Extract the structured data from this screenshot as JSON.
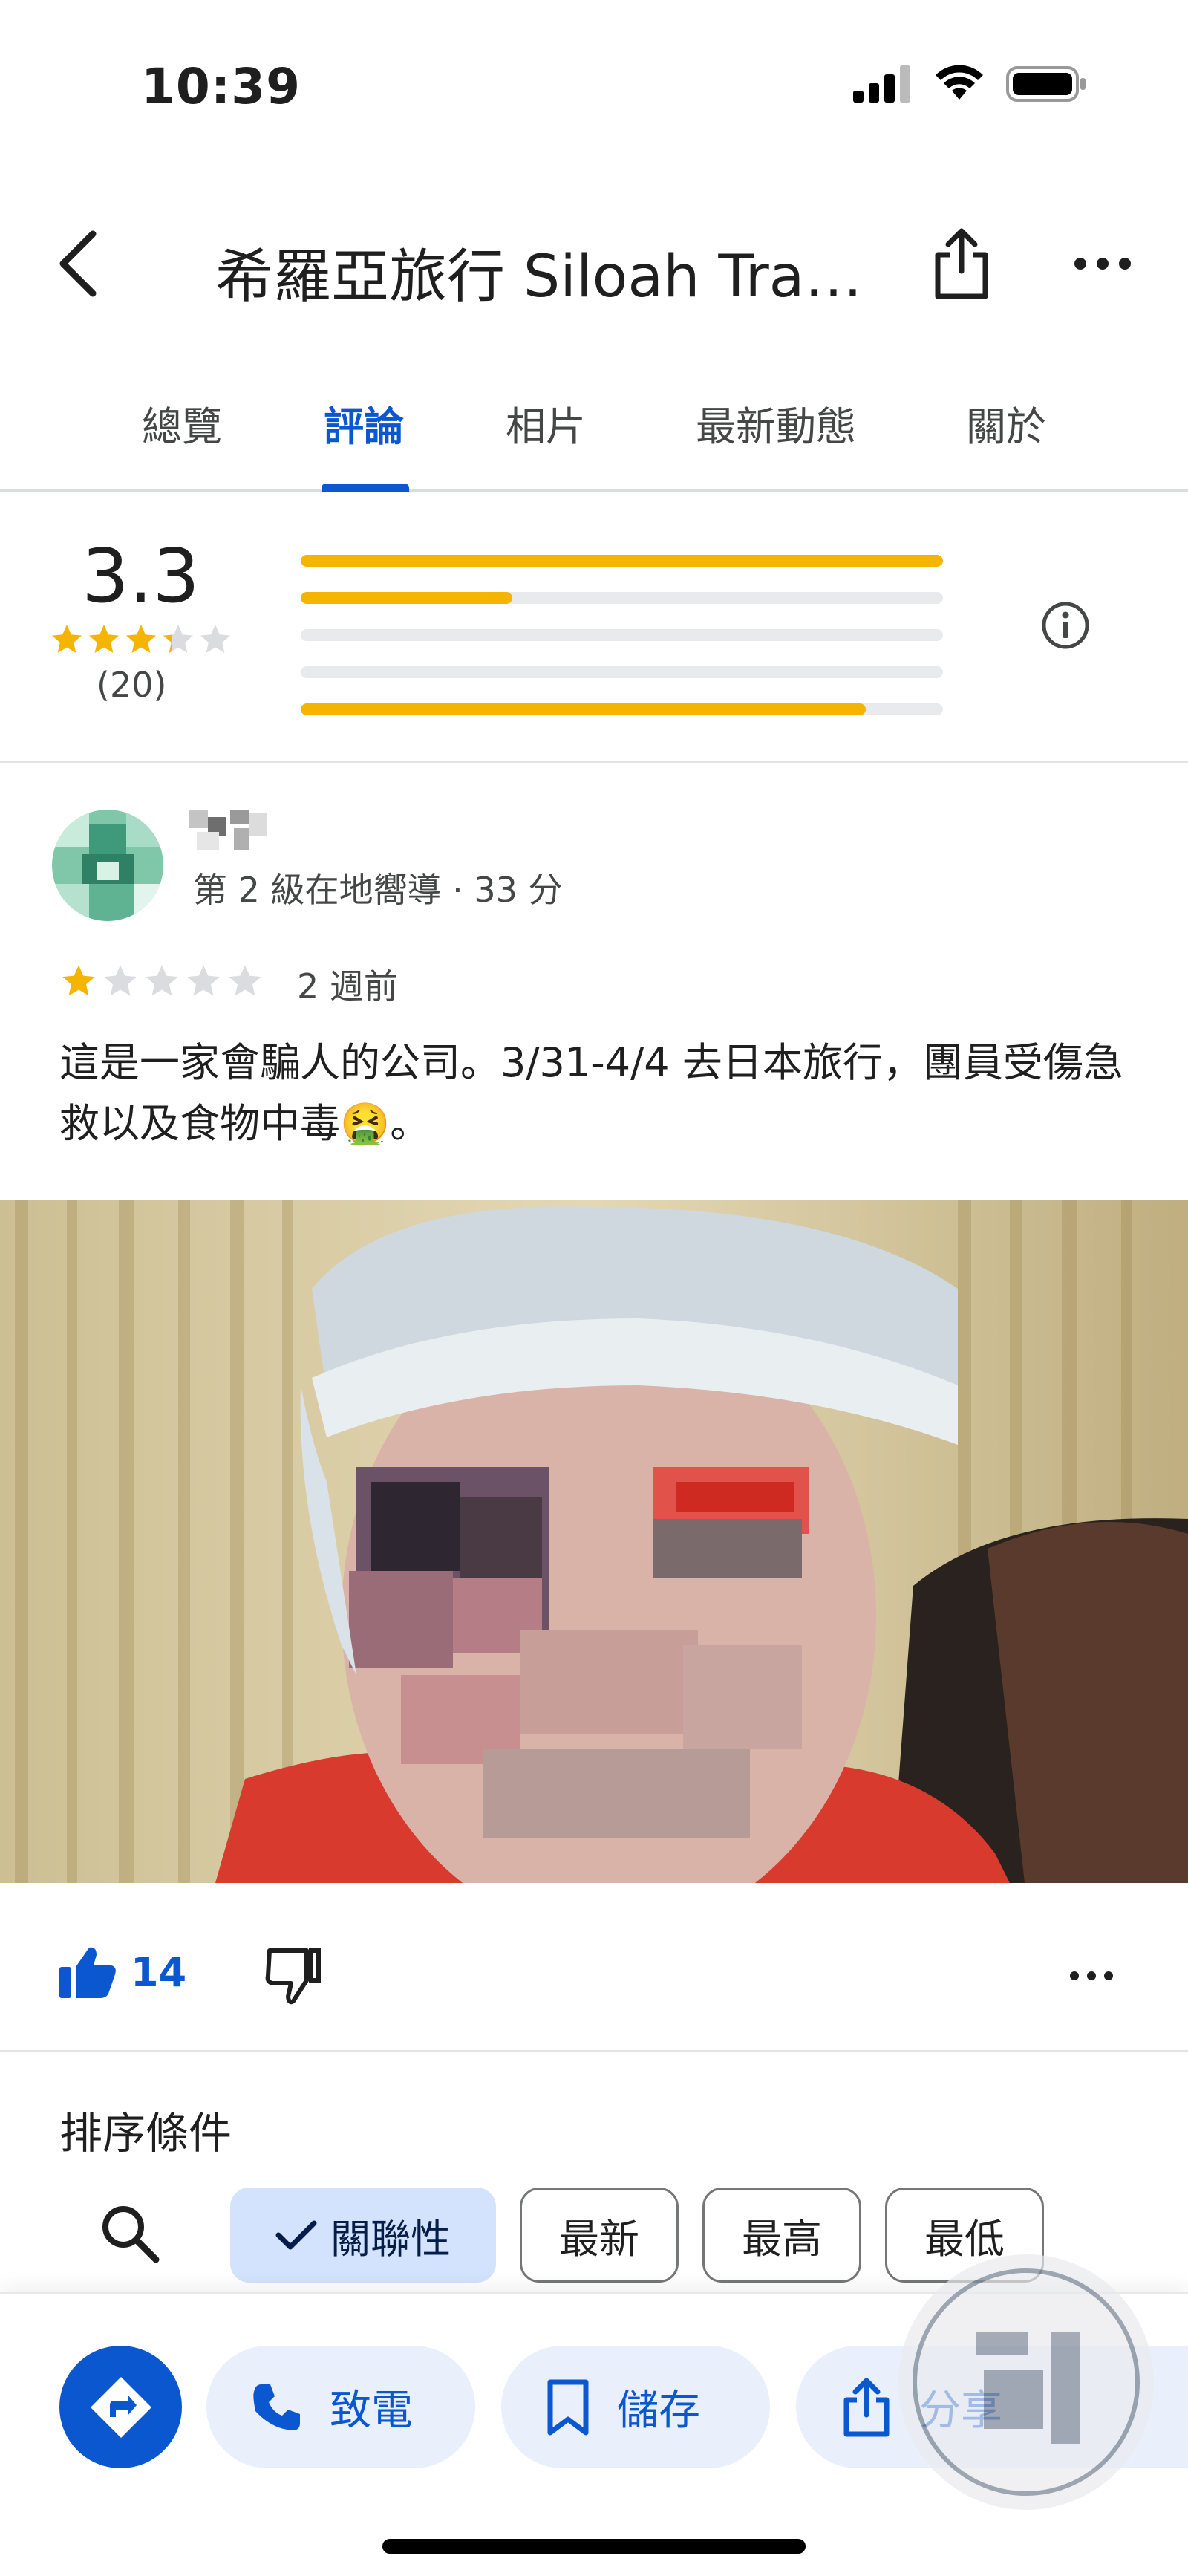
{
  "status_bar": {
    "time": "10:39"
  },
  "header": {
    "title": "希羅亞旅行 Siloah Trav..."
  },
  "tabs": [
    {
      "label": "總覽"
    },
    {
      "label": "評論"
    },
    {
      "label": "相片"
    },
    {
      "label": "最新動態"
    },
    {
      "label": "關於"
    }
  ],
  "active_tab": "評論",
  "rating": {
    "score": "3.3",
    "count": "(20)",
    "stars": 3.3,
    "distribution_fraction": [
      1.0,
      0.33,
      0.0,
      0.0,
      0.88
    ]
  },
  "review": {
    "reviewer_meta": "第 2 級在地嚮導 · 33 分",
    "stars": 1,
    "time": "2 週前",
    "text": "這是一家會騙人的公司。3/31-4/4 去日本旅行，團員受傷急救以及食物中毒🤮。",
    "like_count": "14"
  },
  "sort": {
    "title": "排序條件",
    "chips": [
      "關聯性",
      "最新",
      "最高",
      "最低"
    ],
    "selected": "關聯性"
  },
  "bottom_actions": {
    "call": "致電",
    "save": "儲存",
    "share": "分享"
  },
  "colors": {
    "accent": "#0b57d0",
    "star": "#f4b400",
    "chip_selected": "#d3e3fd"
  },
  "icons": [
    "back-arrow-icon",
    "share-icon",
    "more-icon",
    "info-icon",
    "thumb-up-icon",
    "thumb-down-icon",
    "search-icon",
    "checkmark-icon",
    "directions-icon",
    "phone-icon",
    "bookmark-icon",
    "share-icon"
  ]
}
